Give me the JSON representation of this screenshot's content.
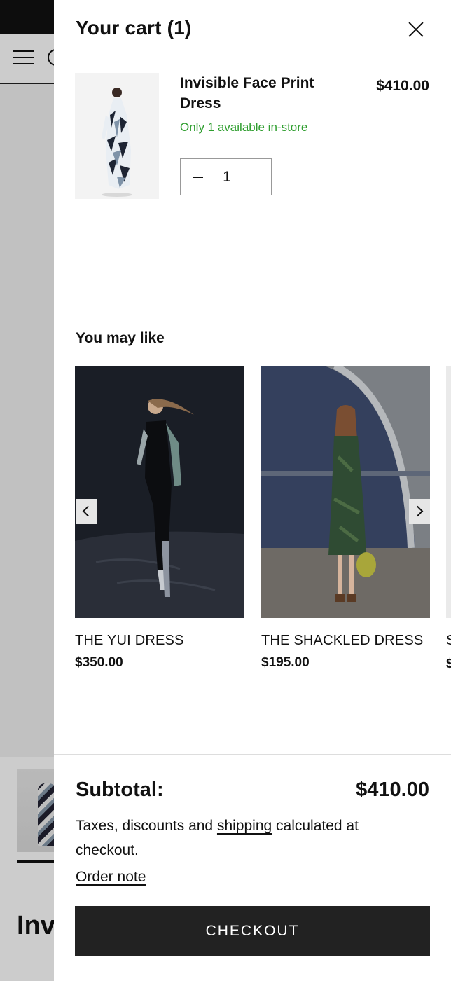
{
  "background": {
    "title_partial": "Inv"
  },
  "cart": {
    "title": "Your cart (1)",
    "item": {
      "name": "Invisible Face Print Dress",
      "price": "$410.00",
      "stock": "Only 1 available in-store",
      "quantity": "1"
    }
  },
  "recommendations": {
    "heading": "You may like",
    "items": [
      {
        "name": "THE YUI DRESS",
        "price": "$350.00"
      },
      {
        "name": "THE SHACKLED DRESS",
        "price": "$195.00"
      }
    ],
    "partial_name": "S",
    "partial_price": "$"
  },
  "footer": {
    "subtotal_label": "Subtotal:",
    "subtotal_value": "$410.00",
    "tax_before": "Taxes, discounts and ",
    "tax_link": "shipping",
    "tax_after": " calculated at checkout.",
    "order_note": "Order note",
    "checkout": "CHECKOUT"
  },
  "colors": {
    "stock_green": "#2f9e2f",
    "checkout_bg": "#222222"
  },
  "icons": [
    "menu-icon",
    "search-icon",
    "close-icon",
    "minus-icon",
    "chevron-left-icon",
    "chevron-right-icon"
  ]
}
